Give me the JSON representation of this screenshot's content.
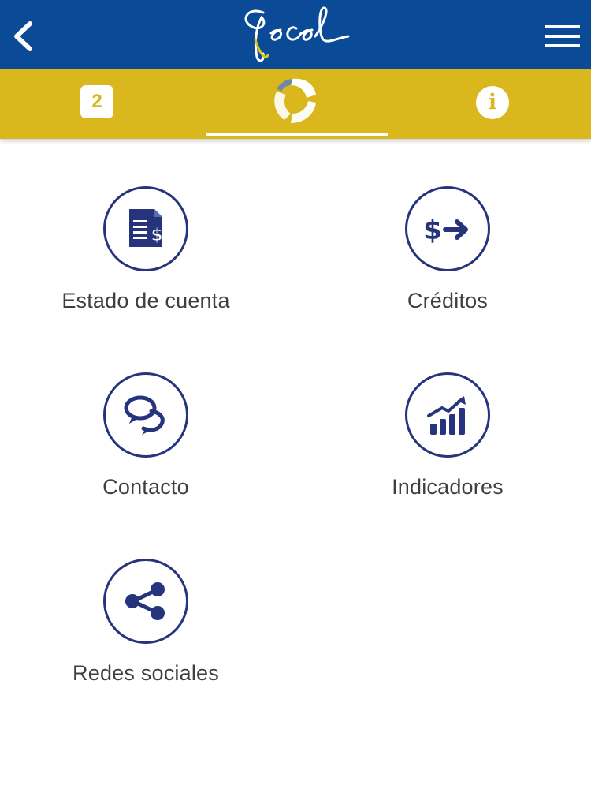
{
  "header": {
    "back_icon": "chevron-left-icon",
    "logo_text": "fecel",
    "menu_icon": "hamburger-menu-icon",
    "bg_color": "#0b4a97"
  },
  "tabs": {
    "bg_color": "#d9b71d",
    "badge_count": "2",
    "center_icon": "cooperative-logo-icon",
    "info_label": "i",
    "active_tab": "center"
  },
  "menu": {
    "accent_color": "#25347c",
    "items": [
      {
        "label": "Estado de cuenta",
        "icon": "account-statement-icon"
      },
      {
        "label": "Créditos",
        "icon": "dollar-arrow-icon"
      },
      {
        "label": "Contacto",
        "icon": "chat-bubbles-icon"
      },
      {
        "label": "Indicadores",
        "icon": "bar-chart-trend-icon"
      },
      {
        "label": "Redes sociales",
        "icon": "share-icon"
      }
    ]
  }
}
